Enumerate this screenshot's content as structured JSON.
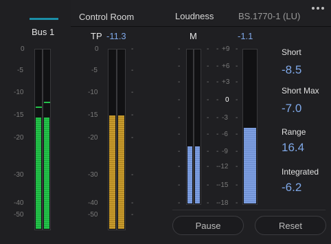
{
  "bus": {
    "title": "Bus 1",
    "accent": "#1b8fa8",
    "scale": [
      "0",
      "-5",
      "-10",
      "-15",
      "-20",
      "-30",
      "-40",
      "-50"
    ],
    "level_fraction": 0.62,
    "peak_fraction": 0.67
  },
  "control_room": {
    "title": "Control Room",
    "tp_label": "TP",
    "tp_value": "-11.3",
    "scale": [
      "0",
      "-5",
      "-10",
      "-15",
      "-20",
      "-30",
      "-40",
      "-50"
    ],
    "level_fraction": 0.63
  },
  "loudness": {
    "title": "Loudness",
    "standard": "BS.1770-1 (LU)",
    "more_icon": "more-dots-icon",
    "m_label": "M",
    "m_value": "-1.1",
    "scale": [
      "+9",
      "+6",
      "+3",
      "0",
      "-3",
      "-6",
      "-9",
      "-12",
      "-15",
      "-18"
    ],
    "m_fill_fraction": 0.37,
    "s_fill_fraction": 0.49,
    "stats": {
      "short_label": "Short",
      "short_value": "-8.5",
      "short_max_label": "Short Max",
      "short_max_value": "-7.0",
      "range_label": "Range",
      "range_value": "16.4",
      "integrated_label": "Integrated",
      "integrated_value": "-6.2"
    },
    "pause_label": "Pause",
    "reset_label": "Reset"
  },
  "colors": {
    "green": "#24c24a",
    "gold": "#c79a2c",
    "blue": "#7d9ee0",
    "value_text": "#7fa8e8"
  }
}
